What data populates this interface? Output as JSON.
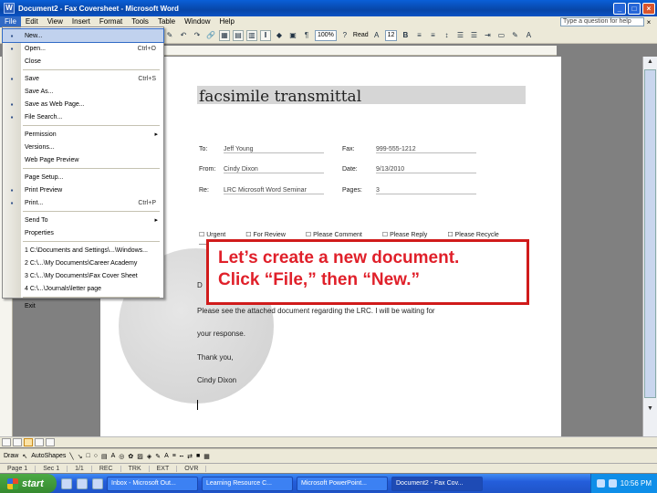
{
  "window": {
    "title": "Document2 - Fax Coversheet - Microsoft Word",
    "controls": [
      "_",
      "□",
      "×"
    ]
  },
  "menubar": {
    "items": [
      "File",
      "Edit",
      "View",
      "Insert",
      "Format",
      "Tools",
      "Table",
      "Window",
      "Help"
    ],
    "help_box": "Type a question for help",
    "close": "×"
  },
  "toolbar": {
    "zoom": "100%",
    "read_label": "Read",
    "font_size": "12"
  },
  "file_menu": {
    "items": [
      {
        "label": "New...",
        "shortcut": "",
        "icon": "new-icon",
        "selected": true
      },
      {
        "label": "Open...",
        "shortcut": "Ctrl+O",
        "icon": "open-icon"
      },
      {
        "label": "Close",
        "shortcut": "",
        "icon": ""
      },
      {
        "sep": true
      },
      {
        "label": "Save",
        "shortcut": "Ctrl+S",
        "icon": "save-icon"
      },
      {
        "label": "Save As...",
        "shortcut": "",
        "icon": ""
      },
      {
        "label": "Save as Web Page...",
        "shortcut": "",
        "icon": "webpage-icon"
      },
      {
        "label": "File Search...",
        "shortcut": "",
        "icon": "filesearch-icon"
      },
      {
        "sep": true
      },
      {
        "label": "Permission",
        "shortcut": "",
        "icon": "",
        "submenu": true
      },
      {
        "label": "Versions...",
        "shortcut": "",
        "icon": ""
      },
      {
        "label": "Web Page Preview",
        "shortcut": "",
        "icon": ""
      },
      {
        "sep": true
      },
      {
        "label": "Page Setup...",
        "shortcut": "",
        "icon": ""
      },
      {
        "label": "Print Preview",
        "shortcut": "",
        "icon": "preview-icon"
      },
      {
        "label": "Print...",
        "shortcut": "Ctrl+P",
        "icon": "print-icon"
      },
      {
        "sep": true
      },
      {
        "label": "Send To",
        "shortcut": "",
        "icon": "",
        "submenu": true
      },
      {
        "label": "Properties",
        "shortcut": "",
        "icon": ""
      },
      {
        "sep": true
      },
      {
        "label": "1 C:\\Documents and Settings\\...\\Windows...",
        "shortcut": "",
        "icon": ""
      },
      {
        "label": "2 C:\\...\\My Documents\\Career Academy",
        "shortcut": "",
        "icon": ""
      },
      {
        "label": "3 C:\\...\\My Documents\\Fax Cover Sheet",
        "shortcut": "",
        "icon": ""
      },
      {
        "label": "4 C:\\...\\Journals\\letter page",
        "shortcut": "",
        "icon": ""
      },
      {
        "sep": true
      },
      {
        "label": "Exit",
        "shortcut": "",
        "icon": ""
      }
    ]
  },
  "document": {
    "heading": "facsimile transmittal",
    "fields": {
      "to_label": "To:",
      "to_value": "Jeff Young",
      "fax_label": "Fax:",
      "fax_value": "999-555-1212",
      "from_label": "From:",
      "from_value": "Cindy Dixon",
      "date_label": "Date:",
      "date_value": "9/13/2010",
      "re_label": "Re:",
      "re_value": "LRC Microsoft Word Seminar",
      "pages_label": "Pages:",
      "pages_value": "3"
    },
    "checks": [
      "Urgent",
      "For Review",
      "Please Comment",
      "Please Reply",
      "Please Recycle"
    ],
    "body_start": "D",
    "body_line1": "Please see the attached document regarding the LRC. I will be waiting for",
    "body_line2": "your response.",
    "closing": "Thank you,",
    "signature": "Cindy Dixon"
  },
  "callout": {
    "line1": "Let’s create a new document.",
    "line2": "Click “File,” then “New.”"
  },
  "drawbar": {
    "draw": "Draw",
    "autoshapes": "AutoShapes"
  },
  "status": {
    "page": "Page 1",
    "sec": "Sec 1",
    "pos": "1/1",
    "rec": "REC",
    "trk": "TRK",
    "ext": "EXT",
    "ovr": "OVR"
  },
  "taskbar": {
    "start": "start",
    "tasks": [
      "Inbox - Microsoft Out...",
      "Learning Resource C...",
      "Microsoft PowerPoint...",
      "Document2 - Fax Cov..."
    ],
    "time": "10:56 PM"
  }
}
